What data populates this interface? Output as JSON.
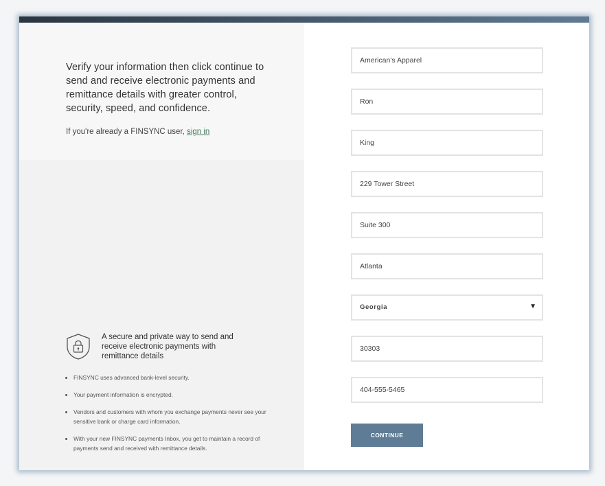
{
  "intro": {
    "message": "Verify your information then click continue to send and receive electronic payments and remittance details with greater control, security, speed, and confidence.",
    "already_user": "If you're already a FINSYNC user,",
    "sign_in": "sign in"
  },
  "security": {
    "heading": "A secure and private way to send and receive electronic payments with remittance details",
    "icon": "shield-lock-icon",
    "bullets": [
      "FINSYNC uses advanced bank-level security.",
      "Your payment information is encrypted.",
      "Vendors and customers with whom you exchange payments never see your sensitive bank or charge card information.",
      "With your new FINSYNC payments Inbox, you get to maintain a record of payments send and received with remittance details."
    ]
  },
  "form": {
    "company": "American's Apparel",
    "first_name": "Ron",
    "last_name": "King",
    "address1": "229 Tower Street",
    "address2": "Suite 300",
    "city": "Atlanta",
    "state": "Georgia",
    "zip": "30303",
    "phone": "404-555-5465",
    "continue_label": "CONTINUE"
  },
  "colors": {
    "accent": "#5e7c95",
    "link": "#3d7a5c",
    "topbar_start": "#2b3540",
    "topbar_end": "#5f7b93"
  }
}
